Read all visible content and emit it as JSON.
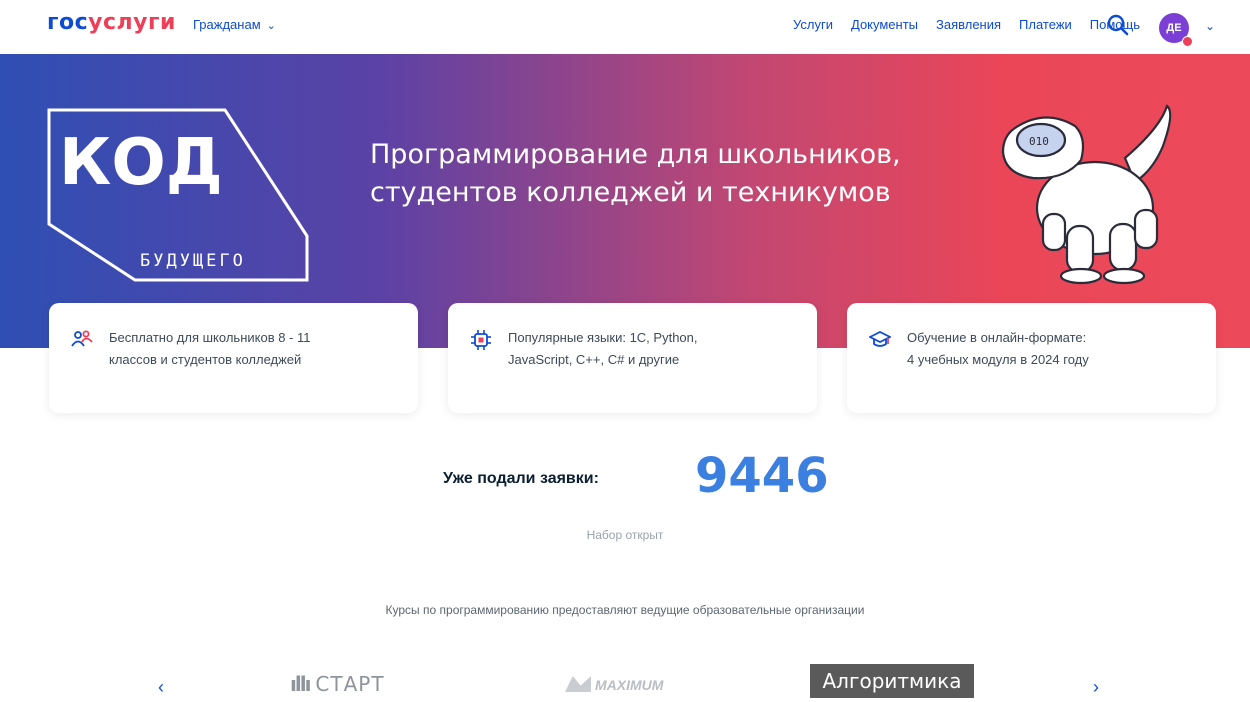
{
  "header": {
    "logo_part1": "гос",
    "logo_part2": "услуги",
    "audience_label": "Гражданам",
    "nav": [
      "Услуги",
      "Документы",
      "Заявления",
      "Платежи",
      "Помощь"
    ],
    "avatar_initials": "ДЕ"
  },
  "banner": {
    "title_line1": "Программирование для школьников,",
    "title_line2": "студентов колледжей и техникумов",
    "logo_main": "КОД",
    "logo_sub": "БУДУЩЕГО"
  },
  "features": [
    {
      "line1": "Бесплатно для школьников 8 - 11",
      "line2": "классов и студентов колледжей",
      "icon": "people-icon"
    },
    {
      "line1": "Популярные языки: 1С, Python,",
      "line2": "JavaScript, C++, C# и другие",
      "icon": "chip-icon"
    },
    {
      "line1": "Обучение в онлайн-формате:",
      "line2": "4 учебных модуля в 2024 году",
      "icon": "graduation-cap-icon"
    }
  ],
  "stats": {
    "label": "Уже подали заявки:",
    "count": "9446",
    "status": "Набор открыт"
  },
  "partners": {
    "intro": "Курсы по программированию предоставляют ведущие образовательные организации",
    "start": "СТАРТ",
    "maximum": "MAXIMUM",
    "algoritmika": "Алгоритмика"
  },
  "colors": {
    "primary": "#0d4cd3",
    "accent": "#ee3f58",
    "count": "#3b7fe0"
  }
}
